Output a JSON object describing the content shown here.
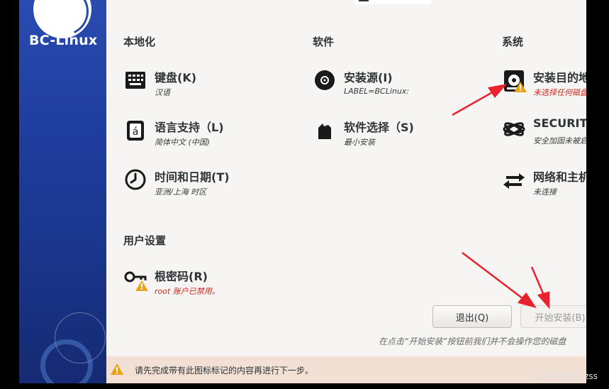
{
  "brand": "BC-Linux",
  "sections": {
    "localization": "本地化",
    "software": "软件",
    "system": "系统",
    "user": "用户设置"
  },
  "spokes": {
    "keyboard": {
      "title": "键盘(K)",
      "status": "汉语",
      "icon": "keyboard-icon"
    },
    "language": {
      "title": "语言支持（L)",
      "status": "简体中文 (中国)",
      "icon": "language-icon"
    },
    "datetime": {
      "title": "时间和日期(T)",
      "status": "亚洲/上海 时区",
      "icon": "clock-icon"
    },
    "source": {
      "title": "安装源(I)",
      "status": "LABEL=BCLinux:",
      "icon": "disc-icon"
    },
    "software_selection": {
      "title": "软件选择（S)",
      "status": "最小安装",
      "icon": "package-icon"
    },
    "destination": {
      "title": "安装目的地",
      "status": "未选择任何磁盘",
      "icon": "harddisk-warning-icon"
    },
    "security": {
      "title": "SECURITY",
      "status": "安全加固未被启",
      "icon": "security-icon"
    },
    "network": {
      "title": "网络和主机",
      "status": "未连接",
      "icon": "network-icon"
    },
    "root": {
      "title": "根密码(R)",
      "status": "root 账户已禁用。",
      "icon": "key-warning-icon"
    }
  },
  "buttons": {
    "quit": "退出(Q)",
    "start": "开始安装(B)"
  },
  "hint": "在点击“开始安装”按钮前我们并不会操作您的磁盘",
  "warning_bar": "请先完成带有此图标标记的内容再进行下一步。",
  "watermark": "CSDN @wsyzss",
  "colors": {
    "sidebar": "#1f3d9e",
    "warning": "#d0271d",
    "arrow": "#e8232d",
    "warnbar": "#f2e0d4"
  }
}
